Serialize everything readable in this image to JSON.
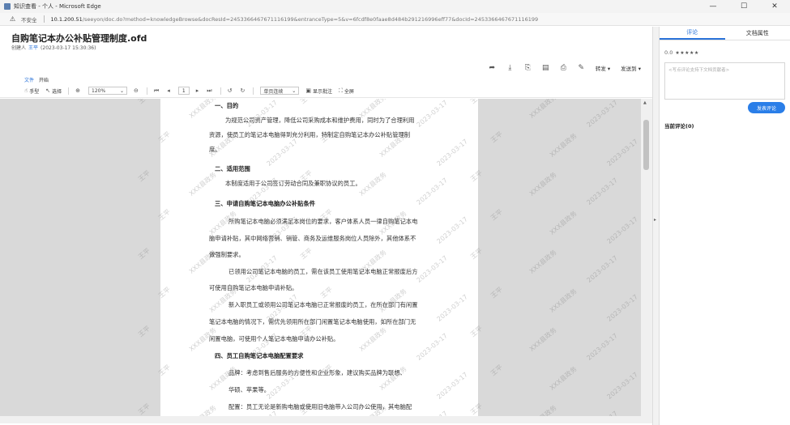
{
  "window": {
    "title": "知识查看 - 个人 - Microsoft Edge",
    "controls": [
      "—",
      "☐",
      "✕"
    ]
  },
  "address_bar": {
    "security_label": "不安全",
    "host": "10.1.200.51",
    "path": "/seeyon/doc.do?method=knowledgeBrowse&docResId=2453366467671116199&entranceType=5&v=6fcdf8e0faae8d484b291216996eff77&docId=2453366467671116199"
  },
  "document": {
    "title": "自购笔记本办公补贴管理制度.ofd",
    "creator_label": "创建人",
    "creator_name": "王平",
    "created_at": "(2023-03-17 15:30:36)"
  },
  "doc_actions": {
    "forward_label": "转发",
    "send_to_label": "发送到"
  },
  "viewer_menu": {
    "file": "文件",
    "start": "开始"
  },
  "viewer_toolbar": {
    "hand": "手型",
    "select": "选择",
    "zoom": "120%",
    "page_input": "1",
    "page_mode": "单页连续",
    "show_annotations": "显示批注",
    "fullscreen": "全屏"
  },
  "page_content": [
    {
      "type": "heading",
      "text": "一、目的"
    },
    {
      "type": "body",
      "text": "为规范公司资产管理，降低公司采购成本和维护费用，同时为了合理利用"
    },
    {
      "type": "body",
      "text": "资源，使员工的笔记本电脑得到充分利用，特制定自购笔记本办公补贴管理制"
    },
    {
      "type": "body",
      "text": "度。"
    },
    {
      "type": "heading",
      "text": "二、适用范围"
    },
    {
      "type": "body",
      "text": "本制度适用于公司签订劳动合同及兼职协议的员工。"
    },
    {
      "type": "heading",
      "text": "三、申请自购笔记本电脑办公补贴条件"
    },
    {
      "type": "body",
      "text": "所购笔记本电脑必须满足本岗位的要求，客户体系人员一律自购笔记本电"
    },
    {
      "type": "body",
      "text": "脑申请补贴，其中网络营销、销管、商务及运维服务岗位人员除外，其他体系不"
    },
    {
      "type": "body",
      "text": "做强制要求。"
    },
    {
      "type": "body",
      "text": "已领用公司笔记本电脑的员工，需在该员工使用笔记本电脑正常报废后方"
    },
    {
      "type": "body",
      "text": "可使用自购笔记本电脑申请补贴。"
    },
    {
      "type": "body",
      "text": "新入职员工或领用公司笔记本电脑已正常报废的员工，在所在部门有闲置"
    },
    {
      "type": "body",
      "text": "笔记本电脑的情况下，需优先领用所在部门闲置笔记本电脑使用，如所在部门无"
    },
    {
      "type": "body",
      "text": "闲置电脑，可使用个人笔记本电脑申请办公补贴。"
    },
    {
      "type": "heading",
      "text": "四、员工自购笔记本电脑配置要求"
    },
    {
      "type": "body",
      "text": "品牌：考虑到售后服务的方便性和企业形象，建议购买品牌为联想、"
    },
    {
      "type": "body",
      "text": "华硕、苹果等。"
    },
    {
      "type": "body",
      "text": "配置：员工无论是新购电脑或使用旧电脑带入公司办公使用，其电脑配"
    }
  ],
  "watermark": {
    "name": "王平",
    "org": "XXX县政务",
    "date": "2023-03-17"
  },
  "right_panel": {
    "tabs": [
      "评论",
      "文档属性"
    ],
    "rating_score": "0.0",
    "rating_stars": "★★★★★",
    "comment_placeholder": "<写点评论支持下文档贡献者>",
    "publish_button": "发表评论",
    "current_comments": "当前评论(0)"
  }
}
